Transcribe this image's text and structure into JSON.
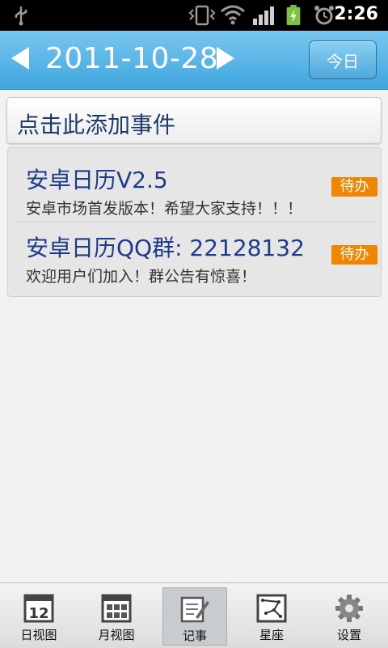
{
  "status_bar": {
    "time": "2:26",
    "icons": [
      "usb-icon",
      "vibrate-icon",
      "wifi-icon",
      "signal-icon",
      "battery-charging-icon",
      "alarm-icon"
    ]
  },
  "header": {
    "date": "2011-10-28",
    "today_label": "今日"
  },
  "add_event_label": "点击此添加事件",
  "events": [
    {
      "title": "安卓日历V2.5",
      "description": "安卓市场首发版本！希望大家支持！！！",
      "badge": "待办"
    },
    {
      "title": "安卓日历QQ群: 22128132",
      "description": "欢迎用户们加入！群公告有惊喜！",
      "badge": "待办"
    }
  ],
  "tabs": [
    {
      "label": "日视图",
      "icon": "day-calendar-icon",
      "active": false
    },
    {
      "label": "月视图",
      "icon": "month-calendar-icon",
      "active": false
    },
    {
      "label": "记事",
      "icon": "note-pen-icon",
      "active": true
    },
    {
      "label": "星座",
      "icon": "constellation-icon",
      "active": false
    },
    {
      "label": "设置",
      "icon": "gear-icon",
      "active": false
    }
  ],
  "colors": {
    "header_blue": "#4ea9dc",
    "badge_orange": "#f08500",
    "title_blue": "#1f3a8a"
  }
}
